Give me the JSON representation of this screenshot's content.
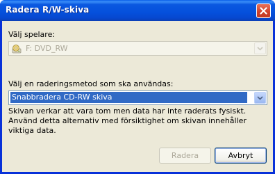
{
  "window": {
    "title": "Radera R/W-skiva"
  },
  "player": {
    "label": "Välj spelare:",
    "selected": "F: DVD_RW",
    "icon": "cd-drive-icon"
  },
  "method": {
    "label": "Välj en raderingsmetod som ska användas:",
    "selected": "Snabbradera CD-RW skiva",
    "description": "Skivan verkar att vara tom men data har inte raderats fysiskt. Använd detta alternativ med försiktighet om skivan innehåller viktiga data."
  },
  "buttons": {
    "erase": "Radera",
    "cancel": "Avbryt"
  },
  "colors": {
    "title_bar": "#0550dc",
    "selection": "#316ac5",
    "dialog_bg": "#ece9d8"
  }
}
